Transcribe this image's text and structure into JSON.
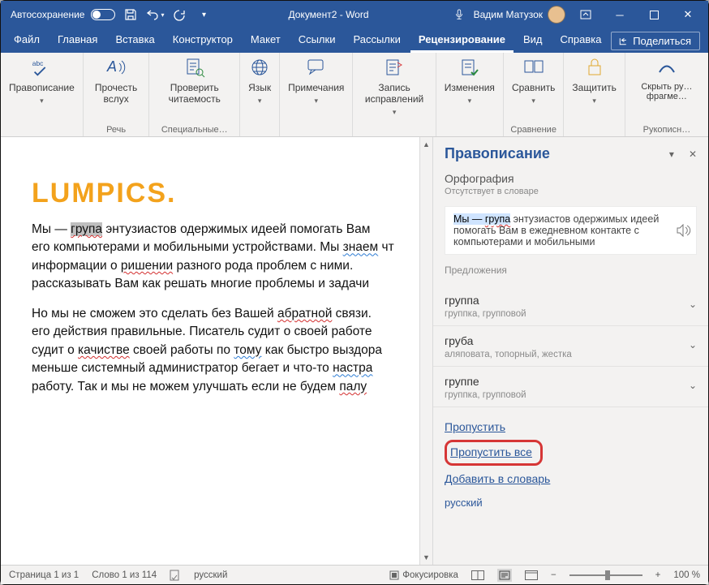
{
  "title_bar": {
    "autosave": "Автосохранение",
    "doc_title": "Документ2 - Word",
    "user": "Вадим Матузок"
  },
  "menu": {
    "tabs": [
      "Файл",
      "Главная",
      "Вставка",
      "Конструктор",
      "Макет",
      "Ссылки",
      "Рассылки",
      "Рецензирование",
      "Вид",
      "Справка"
    ],
    "active_index": 7,
    "share": "Поделиться"
  },
  "ribbon": {
    "spell": "Правописание",
    "read_aloud": "Прочесть вслух",
    "readability": "Проверить читаемость",
    "speech_group": "Речь",
    "special_group": "Специальные…",
    "language": "Язык",
    "comments": "Примечания",
    "track": "Запись исправлений",
    "changes": "Изменения",
    "compare": "Сравнить",
    "compare_group": "Сравнение",
    "protect": "Защитить",
    "ink": "Скрыть ру… фрагме…",
    "ink_group": "Рукописн…"
  },
  "document": {
    "heading": "LUMPICS.",
    "p1_pre": "Мы — ",
    "p1_word": "група",
    "p1_post": " энтузиастов одержимых идеей помогать Вам ",
    "p1_l2_a": "его компьютерами и мобильными устройствами. Мы ",
    "p1_l2_u": "знаем",
    "p1_l2_b": " чт",
    "p1_l3_a": "информации о ",
    "p1_l3_u": "ришении",
    "p1_l3_b": " разного рода проблем с ними. ",
    "p1_l4": "рассказывать Вам как решать многие проблемы и задачи",
    "p2_l1_a": "Но мы не сможем это сделать без Вашей ",
    "p2_l1_u": "абратной",
    "p2_l1_b": " связи. ",
    "p2_l2": "его действия правильные. Писатель судит о своей работе",
    "p2_l3_a": "судит о ",
    "p2_l3_u": "качистве",
    "p2_l3_b": " своей работы по ",
    "p2_l3_u2": "тому",
    "p2_l3_c": " как быстро выздора",
    "p2_l4_a": "меньше системный администратор бегает и что-то ",
    "p2_l4_u": "настра",
    "p2_l5_a": "работу. Так и мы не можем улучшать если не будем ",
    "p2_l5_u": "палу"
  },
  "pane": {
    "title": "Правописание",
    "subtype": "Орфография",
    "absent": "Отсутствует в словаре",
    "sentence_sel": "Мы — ",
    "sentence_err": "група",
    "sentence_rest1": " энтузиастов одержимых идеей",
    "sentence_rest2": "помогать Вам в ежедневном контакте с",
    "sentence_rest3": "компьютерами и мобильными",
    "suggest_header": "Предложения",
    "suggestions": [
      {
        "word": "группа",
        "syn": "группка, групповой"
      },
      {
        "word": "груба",
        "syn": "аляповата, топорный, жестка"
      },
      {
        "word": "группе",
        "syn": "группка, групповой"
      }
    ],
    "skip": "Пропустить",
    "skip_all": "Пропустить все",
    "add_dict": "Добавить в словарь",
    "lang": "русский"
  },
  "status": {
    "page": "Страница 1 из 1",
    "words": "Слово 1 из 114",
    "lang": "русский",
    "focus": "Фокусировка",
    "zoom": "100 %"
  }
}
